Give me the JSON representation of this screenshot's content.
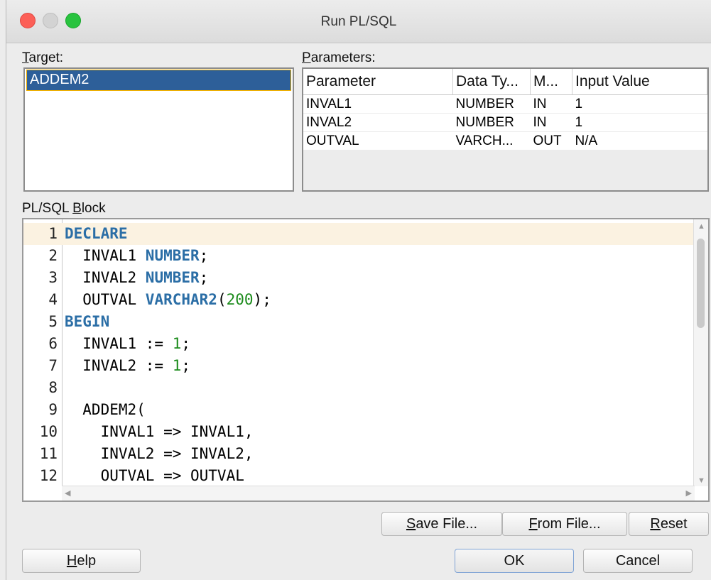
{
  "window": {
    "title": "Run PL/SQL"
  },
  "target": {
    "label_first": "T",
    "label_rest": "arget:",
    "items": [
      "ADDEM2"
    ]
  },
  "parameters": {
    "label_first": "P",
    "label_rest": "arameters:",
    "columns": [
      "Parameter",
      "Data Ty...",
      "M...",
      "Input Value"
    ],
    "rows": [
      [
        "INVAL1",
        "NUMBER",
        "IN",
        "1"
      ],
      [
        "INVAL2",
        "NUMBER",
        "IN",
        "1"
      ],
      [
        "OUTVAL",
        "VARCH...",
        "OUT",
        "N/A"
      ]
    ]
  },
  "block": {
    "label_a": "PL/SQL ",
    "label_u": "B",
    "label_b": "lock",
    "lines": [
      {
        "n": "1",
        "code": [
          [
            "kw",
            "DECLARE"
          ]
        ]
      },
      {
        "n": "2",
        "code": [
          [
            "t",
            "  INVAL1 "
          ],
          [
            "kw",
            "NUMBER"
          ],
          [
            "t",
            ";"
          ]
        ]
      },
      {
        "n": "3",
        "code": [
          [
            "t",
            "  INVAL2 "
          ],
          [
            "kw",
            "NUMBER"
          ],
          [
            "t",
            ";"
          ]
        ]
      },
      {
        "n": "4",
        "code": [
          [
            "t",
            "  OUTVAL "
          ],
          [
            "kw",
            "VARCHAR2"
          ],
          [
            "t",
            "("
          ],
          [
            "num",
            "200"
          ],
          [
            "t",
            ");"
          ]
        ]
      },
      {
        "n": "5",
        "code": [
          [
            "kw",
            "BEGIN"
          ]
        ]
      },
      {
        "n": "6",
        "code": [
          [
            "t",
            "  INVAL1 := "
          ],
          [
            "num",
            "1"
          ],
          [
            "t",
            ";"
          ]
        ]
      },
      {
        "n": "7",
        "code": [
          [
            "t",
            "  INVAL2 := "
          ],
          [
            "num",
            "1"
          ],
          [
            "t",
            ";"
          ]
        ]
      },
      {
        "n": "8",
        "code": []
      },
      {
        "n": "9",
        "code": [
          [
            "t",
            "  ADDEM2("
          ]
        ]
      },
      {
        "n": "10",
        "code": [
          [
            "t",
            "    INVAL1 => INVAL1,"
          ]
        ]
      },
      {
        "n": "11",
        "code": [
          [
            "t",
            "    INVAL2 => INVAL2,"
          ]
        ]
      },
      {
        "n": "12",
        "code": [
          [
            "t",
            "    OUTVAL => OUTVAL"
          ]
        ]
      }
    ]
  },
  "buttons": {
    "save_u": "S",
    "save_rest": "ave File...",
    "from_u": "F",
    "from_rest": "rom File...",
    "reset_u": "R",
    "reset_rest": "eset",
    "help_u": "H",
    "help_rest": "elp",
    "ok": "OK",
    "cancel": "Cancel"
  },
  "colors": {
    "keyword": "#2b6ea6",
    "number": "#1b8b1b",
    "selection": "#2d5f99",
    "current_line": "#fbf2e1"
  }
}
